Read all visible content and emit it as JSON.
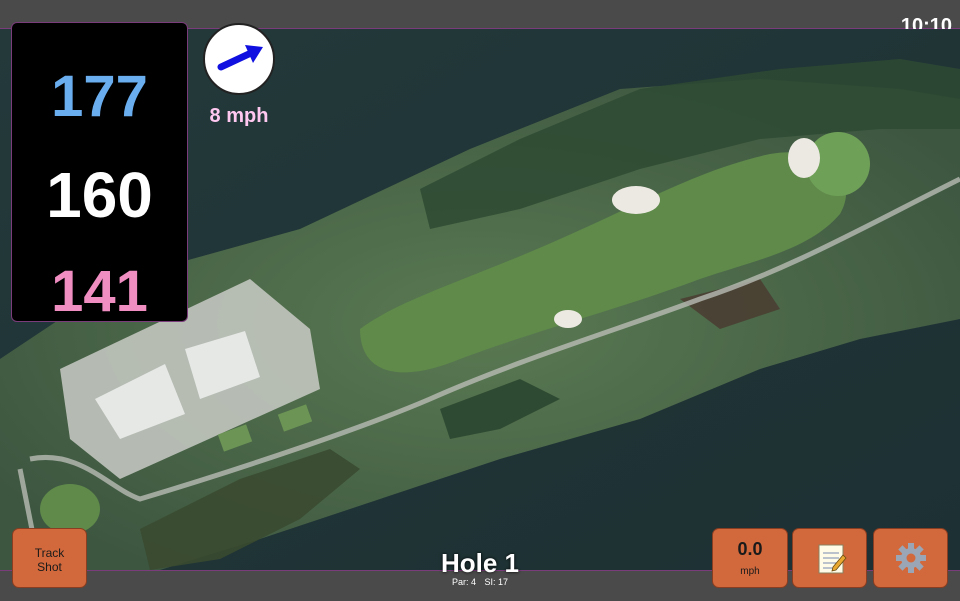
{
  "status_bar": {
    "time": "10:10"
  },
  "distances": {
    "back": "177",
    "center": "160",
    "front": "141",
    "colors": {
      "back": "#6aaef0",
      "center": "#ffffff",
      "front": "#f08ec2"
    }
  },
  "wind": {
    "speed_label": "8 mph",
    "arrow_color": "#1010e0",
    "icon": "wind-direction-arrow-icon"
  },
  "hole": {
    "title": "Hole 1",
    "par_label": "Par: 4",
    "si_label": "SI: 17"
  },
  "buttons": {
    "track_shot_line1": "Track",
    "track_shot_line2": "Shot",
    "speed_value": "0.0",
    "speed_unit": "mph",
    "notes_icon": "notepad-icon",
    "settings_icon": "gear-icon",
    "accent": "#d2693c"
  }
}
